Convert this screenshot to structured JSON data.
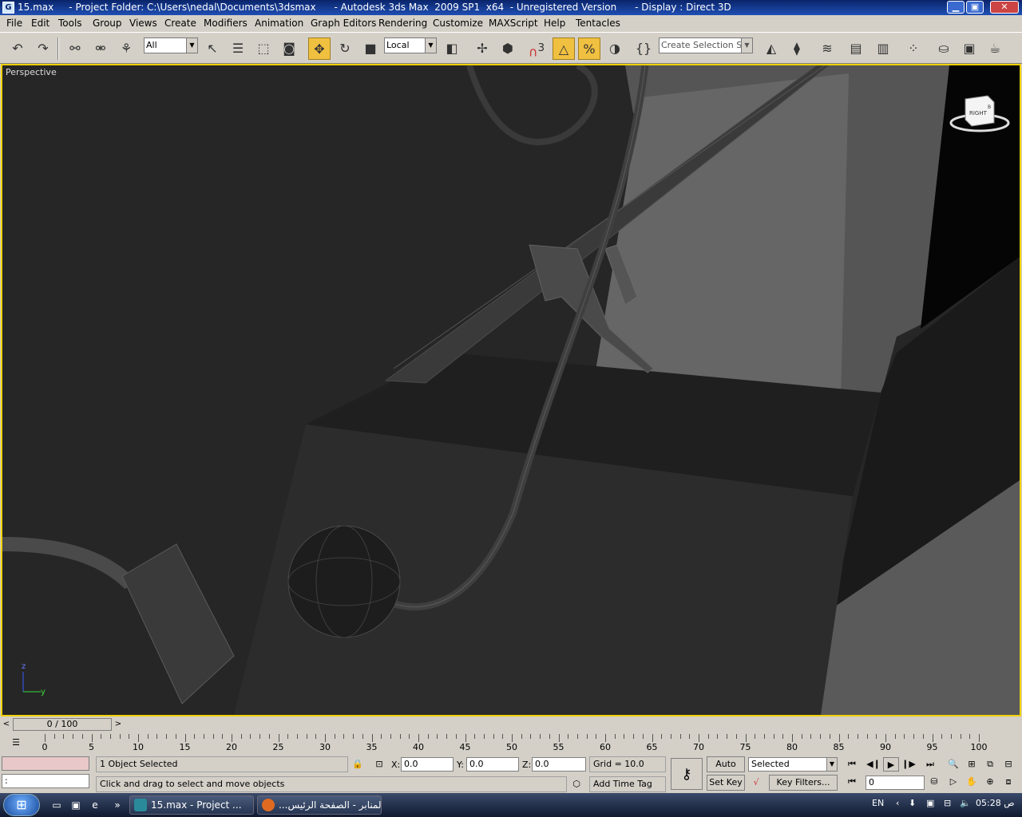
{
  "window": {
    "title": "15.max     - Project Folder: C:\\Users\\nedal\\Documents\\3dsmax      - Autodesk 3ds Max  2009 SP1  x64  - Unregistered Version      - Display : Direct 3D",
    "min_label": "▁",
    "max_label": "▣",
    "close_label": "✕"
  },
  "menu": [
    "File",
    "Edit",
    "Tools",
    "Group",
    "Views",
    "Create",
    "Modifiers",
    "Animation",
    "Graph Editors",
    "Rendering",
    "Customize",
    "MAXScript",
    "Help",
    "Tentacles"
  ],
  "toolbar": {
    "selection_filter": "All",
    "ref_coord": "Local",
    "named_selection_placeholder": "Create Selection Set",
    "snap_label": "3",
    "percent_snap_label": "%"
  },
  "viewport": {
    "label": "Perspective",
    "viewcube_label": "RIGHT",
    "viewcube_side": "B",
    "axis_x": "y",
    "axis_z": "z"
  },
  "timeslider": {
    "position": "0 / 100",
    "prev": "<",
    "next": ">"
  },
  "trackbar": {
    "ticks": [
      "0",
      "5",
      "10",
      "15",
      "20",
      "25",
      "30",
      "35",
      "40",
      "45",
      "50",
      "55",
      "60",
      "65",
      "70",
      "75",
      "80",
      "85",
      "90",
      "95",
      "100"
    ]
  },
  "status": {
    "selection_info": "1 Object Selected",
    "prompt": "Click and drag to select and move objects",
    "script_listener": ":",
    "x_label": "X:",
    "x_value": "0.0",
    "y_label": "Y:",
    "y_value": "0.0",
    "z_label": "Z:",
    "z_value": "0.0",
    "grid": "Grid = 10.0",
    "add_time_tag": "Add Time Tag",
    "auto_key": "Auto Key",
    "set_key": "Set Key",
    "key_mode": "Selected",
    "key_filters": "Key Filters...",
    "current_frame": "0"
  },
  "taskbar": {
    "tasks": [
      {
        "label": "15.max     - Project ...",
        "icon_color": "#2a8a9a"
      },
      {
        "label": "...المنابر - الصفحة الرئيس",
        "icon_color": "#e06a20"
      }
    ],
    "language": "EN",
    "clock": "05:28 ص"
  }
}
